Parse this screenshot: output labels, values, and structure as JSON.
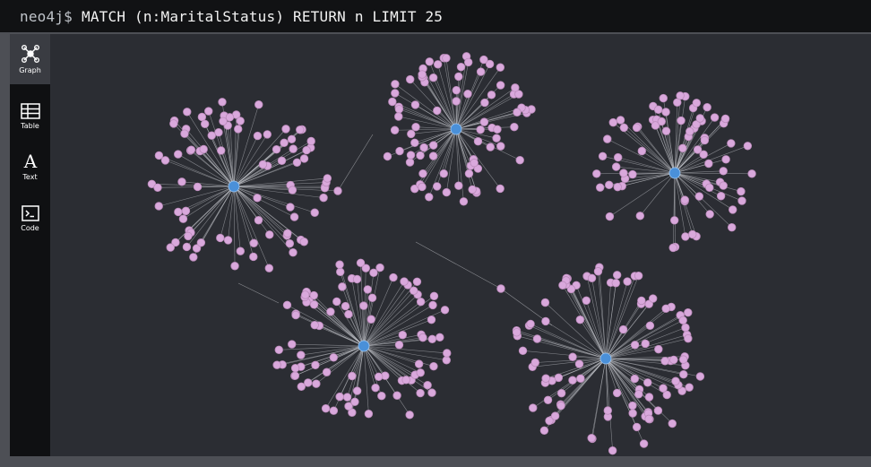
{
  "query_bar": {
    "prompt": "neo4j$",
    "query": "MATCH (n:MaritalStatus) RETURN n LIMIT 25"
  },
  "sidebar": {
    "items": [
      {
        "label": "Graph",
        "icon": "graph-icon",
        "active": true
      },
      {
        "label": "Table",
        "icon": "table-icon",
        "active": false
      },
      {
        "label": "Text",
        "icon": "text-icon",
        "active": false
      },
      {
        "label": "Code",
        "icon": "code-icon",
        "active": false
      }
    ]
  },
  "colors": {
    "center_node": "#4a90d9",
    "leaf_node": "#d9a8dc",
    "edge": "#c9cbd0",
    "canvas_bg": "#2b2d33"
  }
}
